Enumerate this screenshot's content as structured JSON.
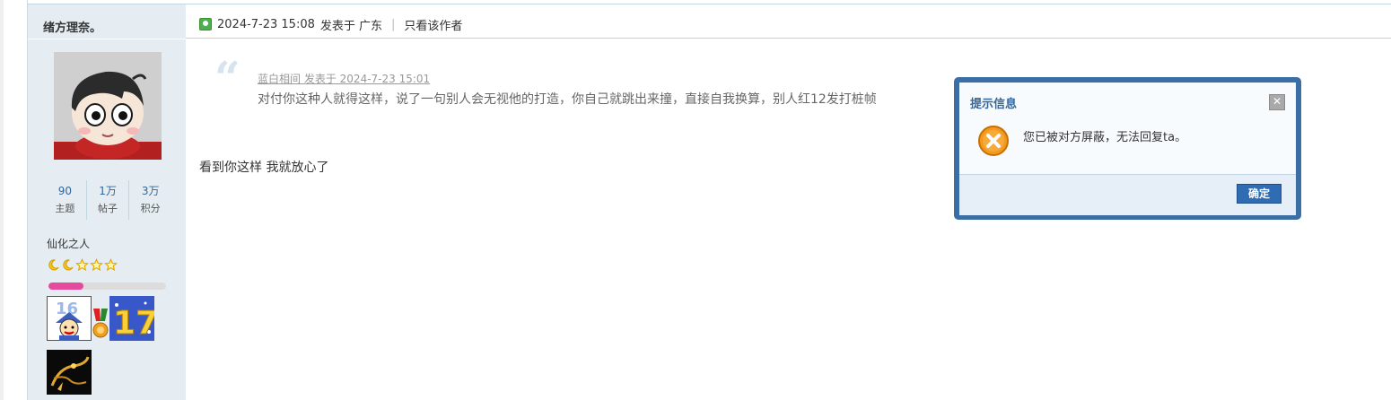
{
  "sidebar": {
    "author_name": "绪方理奈。",
    "stats": [
      {
        "value": "90",
        "label": "主题"
      },
      {
        "value": "1万",
        "label": "帖子"
      },
      {
        "value": "3万",
        "label": "积分"
      }
    ],
    "rank_title": "仙化之人",
    "rank_icons": [
      "moon-icon",
      "moon-icon",
      "star-icon",
      "star-icon",
      "star-icon"
    ],
    "progress_fraction": 0.3,
    "medal_icons": [
      "medal-16-badge",
      "medal-ribbon",
      "medal-17-badge",
      "medal-golden-dragon"
    ]
  },
  "post": {
    "timestamp": "2024-7-23 15:08",
    "posted_from": "发表于 广东",
    "author_only_link": "只看该作者",
    "quote": {
      "author": "蓝白相间",
      "meta_suffix": "发表于 2024-7-23 15:01",
      "text": "对付你这种人就得这样，说了一句别人会无视他的打造，你自己就跳出来撞，直接自我换算，别人红12发打桩帧"
    },
    "reply": "看到你这样 我就放心了"
  },
  "dialog": {
    "title": "提示信息",
    "message": "您已被对方屏蔽，无法回复ta。",
    "ok_label": "确定",
    "close_label": "✕",
    "icon": "error-icon",
    "border_color": "#3a6ea5",
    "title_color": "#336699"
  }
}
